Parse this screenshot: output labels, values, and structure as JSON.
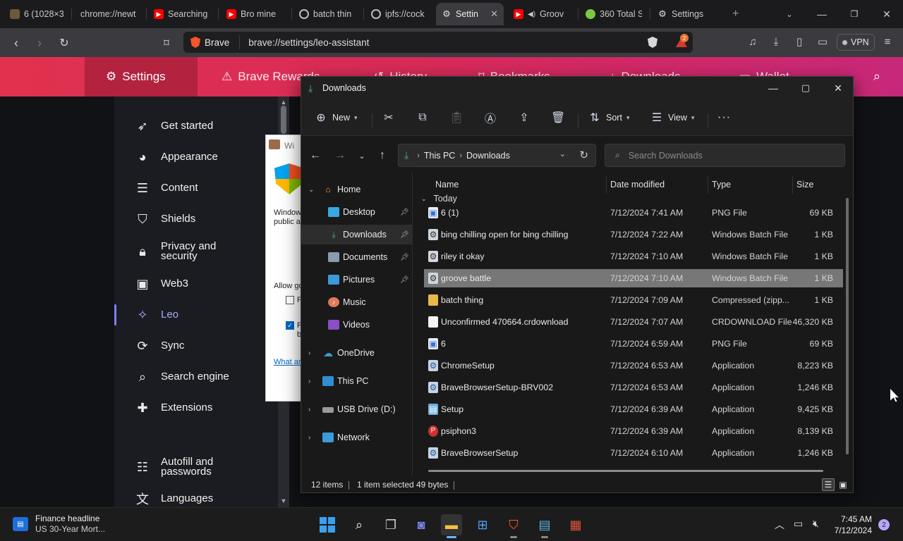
{
  "browser": {
    "tabs": [
      {
        "title": "6 (1028×3",
        "color": "#6b5a3a",
        "active": false
      },
      {
        "title": "chrome://newt",
        "color": "",
        "active": false
      },
      {
        "title": "Searching",
        "color": "#ff0000",
        "active": false
      },
      {
        "title": "Bro mine",
        "color": "#ff0000",
        "active": false
      },
      {
        "title": "batch thin",
        "color": "#bbbbbb",
        "active": false
      },
      {
        "title": "ipfs://cock",
        "color": "#bbbbbb",
        "active": false
      },
      {
        "title": "Settin",
        "color": "#bbbbbb",
        "active": true
      },
      {
        "title": "Groov",
        "color": "#ff0000",
        "active": false
      },
      {
        "title": "360 Total S",
        "color": "#7ac943",
        "active": false
      },
      {
        "title": "Settings",
        "color": "#bbbbbb",
        "active": false
      }
    ],
    "new_tab": "+",
    "address": {
      "chip": "Brave",
      "url": "brave://settings/leo-assistant"
    },
    "shields_badge": "2",
    "vpn_label": "VPN"
  },
  "settings_header": {
    "tabs": [
      {
        "label": "Settings",
        "icon": "gear-icon"
      },
      {
        "label": "Brave Rewards",
        "icon": "triangle-icon"
      },
      {
        "label": "History",
        "icon": "history-icon"
      },
      {
        "label": "Bookmarks",
        "icon": "bookmark-icon"
      },
      {
        "label": "Downloads",
        "icon": "download-icon"
      },
      {
        "label": "Wallet",
        "icon": "wallet-icon"
      }
    ]
  },
  "settings_sidebar": {
    "items": [
      {
        "label": "Get started",
        "icon": "rocket-icon",
        "glyph": "🚀"
      },
      {
        "label": "Appearance",
        "icon": "palette-icon",
        "glyph": "🎨"
      },
      {
        "label": "Content",
        "icon": "content-icon",
        "glyph": "☰"
      },
      {
        "label": "Shields",
        "icon": "shield-icon",
        "glyph": "⛉"
      },
      {
        "label": "Privacy and security",
        "icon": "lock-icon",
        "glyph": "🔒"
      },
      {
        "label": "Web3",
        "icon": "wallet-icon",
        "glyph": "▣"
      },
      {
        "label": "Leo",
        "icon": "leo-star-icon",
        "glyph": "✧"
      },
      {
        "label": "Sync",
        "icon": "sync-icon",
        "glyph": "⟳"
      },
      {
        "label": "Search engine",
        "icon": "search-icon",
        "glyph": "⌕"
      },
      {
        "label": "Extensions",
        "icon": "puzzle-icon",
        "glyph": "✚"
      },
      {
        "label": "Autofill and passwords",
        "icon": "list-icon",
        "glyph": "☷"
      },
      {
        "label": "Languages",
        "icon": "translate-icon",
        "glyph": "文"
      }
    ],
    "active": "Leo"
  },
  "bg_dialog": {
    "title": "Wi",
    "text1": "Window public ar",
    "text2": "Allow go",
    "check1": "P",
    "check2": "P b",
    "link": "What ar"
  },
  "explorer": {
    "title": "Downloads",
    "commands": {
      "new": "New",
      "sort": "Sort",
      "view": "View",
      "more": "···"
    },
    "breadcrumb": [
      "This PC",
      "Downloads"
    ],
    "search_placeholder": "Search Downloads",
    "tree": [
      {
        "label": "Home",
        "icon": "home-icon",
        "level": 0,
        "expanded": true
      },
      {
        "label": "Desktop",
        "icon": "desktop-folder-icon",
        "level": 1,
        "pinned": true
      },
      {
        "label": "Downloads",
        "icon": "downloads-folder-icon",
        "level": 1,
        "pinned": true,
        "selected": true
      },
      {
        "label": "Documents",
        "icon": "documents-folder-icon",
        "level": 1,
        "pinned": true
      },
      {
        "label": "Pictures",
        "icon": "pictures-folder-icon",
        "level": 1,
        "pinned": true
      },
      {
        "label": "Music",
        "icon": "music-folder-icon",
        "level": 1
      },
      {
        "label": "Videos",
        "icon": "videos-folder-icon",
        "level": 1
      },
      {
        "label": "OneDrive",
        "icon": "onedrive-icon",
        "level": 0
      },
      {
        "label": "This PC",
        "icon": "this-pc-icon",
        "level": 0
      },
      {
        "label": "USB Drive (D:)",
        "icon": "usb-drive-icon",
        "level": 0
      },
      {
        "label": "Network",
        "icon": "network-icon",
        "level": 0
      }
    ],
    "columns": {
      "name": "Name",
      "date": "Date modified",
      "type": "Type",
      "size": "Size"
    },
    "group_label": "Today",
    "files": [
      {
        "name": "6 (1)",
        "date": "7/12/2024 7:41 AM",
        "type": "PNG File",
        "size": "69 KB",
        "icon": "image-file-icon"
      },
      {
        "name": "bing chilling open for bing chilling",
        "date": "7/12/2024 7:22 AM",
        "type": "Windows Batch File",
        "size": "1 KB",
        "icon": "batch-file-icon"
      },
      {
        "name": "riley it okay",
        "date": "7/12/2024 7:10 AM",
        "type": "Windows Batch File",
        "size": "1 KB",
        "icon": "batch-file-icon"
      },
      {
        "name": "groove battle",
        "date": "7/12/2024 7:10 AM",
        "type": "Windows Batch File",
        "size": "1 KB",
        "icon": "batch-file-icon",
        "selected": true
      },
      {
        "name": "batch thing",
        "date": "7/12/2024 7:09 AM",
        "type": "Compressed (zipp...",
        "size": "1 KB",
        "icon": "zip-folder-icon"
      },
      {
        "name": "Unconfirmed 470664.crdownload",
        "date": "7/12/2024 7:07 AM",
        "type": "CRDOWNLOAD File",
        "size": "46,320 KB",
        "icon": "blank-file-icon"
      },
      {
        "name": "6",
        "date": "7/12/2024 6:59 AM",
        "type": "PNG File",
        "size": "69 KB",
        "icon": "image-file-icon"
      },
      {
        "name": "ChromeSetup",
        "date": "7/12/2024 6:53 AM",
        "type": "Application",
        "size": "8,223 KB",
        "icon": "installer-icon"
      },
      {
        "name": "BraveBrowserSetup-BRV002",
        "date": "7/12/2024 6:53 AM",
        "type": "Application",
        "size": "1,246 KB",
        "icon": "installer-icon"
      },
      {
        "name": "Setup",
        "date": "7/12/2024 6:39 AM",
        "type": "Application",
        "size": "9,425 KB",
        "icon": "setup-app-icon"
      },
      {
        "name": "psiphon3",
        "date": "7/12/2024 6:39 AM",
        "type": "Application",
        "size": "8,139 KB",
        "icon": "psiphon-icon"
      },
      {
        "name": "BraveBrowserSetup",
        "date": "7/12/2024 6:10 AM",
        "type": "Application",
        "size": "1,246 KB",
        "icon": "installer-icon"
      }
    ],
    "status": {
      "count": "12 items",
      "selected": "1 item selected",
      "bytes": "49 bytes"
    }
  },
  "taskbar": {
    "widget_title": "Finance headline",
    "widget_sub": "US 30-Year Mort...",
    "time": "7:45 AM",
    "date": "7/12/2024",
    "notifications": "2"
  },
  "colors": {
    "accent": "#e0324e",
    "leo_active": "#a7a7ff",
    "selected_row": "#777777"
  }
}
